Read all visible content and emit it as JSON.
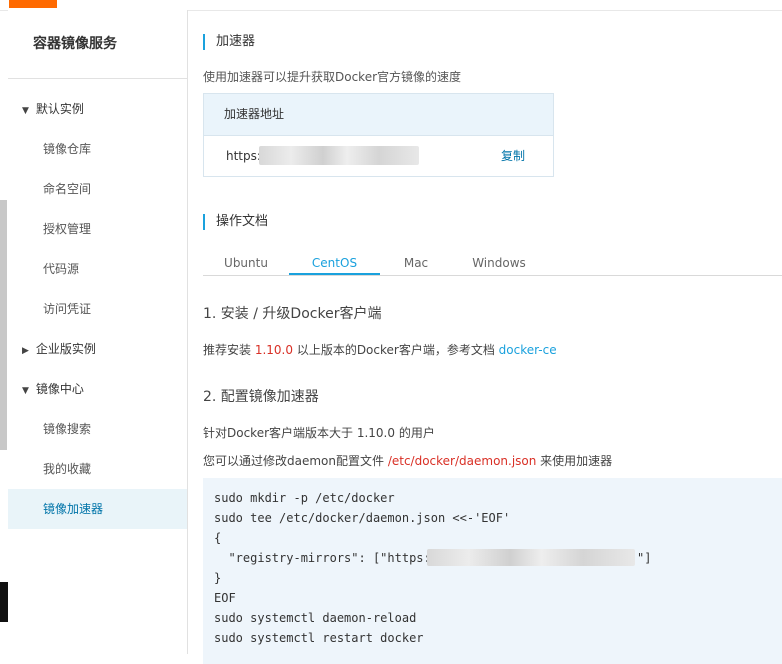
{
  "sidebar": {
    "title": "容器镜像服务",
    "groups": [
      {
        "label": "默认实例",
        "expanded": true,
        "items": [
          "镜像仓库",
          "命名空间",
          "授权管理",
          "代码源",
          "访问凭证"
        ]
      },
      {
        "label": "企业版实例",
        "expanded": false,
        "items": []
      },
      {
        "label": "镜像中心",
        "expanded": true,
        "items": [
          "镜像搜索",
          "我的收藏",
          "镜像加速器"
        ]
      }
    ],
    "active_item": "镜像加速器"
  },
  "accelerator": {
    "title": "加速器",
    "description": "使用加速器可以提升获取Docker官方镜像的速度",
    "table_header": "加速器地址",
    "url_prefix": "https:",
    "copy_label": "复制"
  },
  "docs": {
    "title": "操作文档",
    "tabs": [
      "Ubuntu",
      "CentOS",
      "Mac",
      "Windows"
    ],
    "active_tab": "CentOS",
    "step1": {
      "title": "1. 安装 / 升级Docker客户端",
      "text_before": "推荐安装 ",
      "version": "1.10.0",
      "text_after": " 以上版本的Docker客户端，参考文档 ",
      "link": "docker-ce"
    },
    "step2": {
      "title": "2. 配置镜像加速器",
      "line1": "针对Docker客户端版本大于 1.10.0 的用户",
      "line2_before": "您可以通过修改daemon配置文件 ",
      "config_path": "/etc/docker/daemon.json",
      "line2_after": " 来使用加速器"
    },
    "code_lines": [
      "sudo mkdir -p /etc/docker",
      "sudo tee /etc/docker/daemon.json <<-'EOF'",
      "{",
      "  \"registry-mirrors\": [\"https:",
      "}",
      "EOF",
      "sudo systemctl daemon-reload",
      "sudo systemctl restart docker"
    ],
    "code_mirror_suffix": "\"]"
  },
  "colors": {
    "accent": "#1aa1dd",
    "brand": "#ff6a00",
    "link": "#0074a9",
    "highlight_red": "#d93026"
  }
}
